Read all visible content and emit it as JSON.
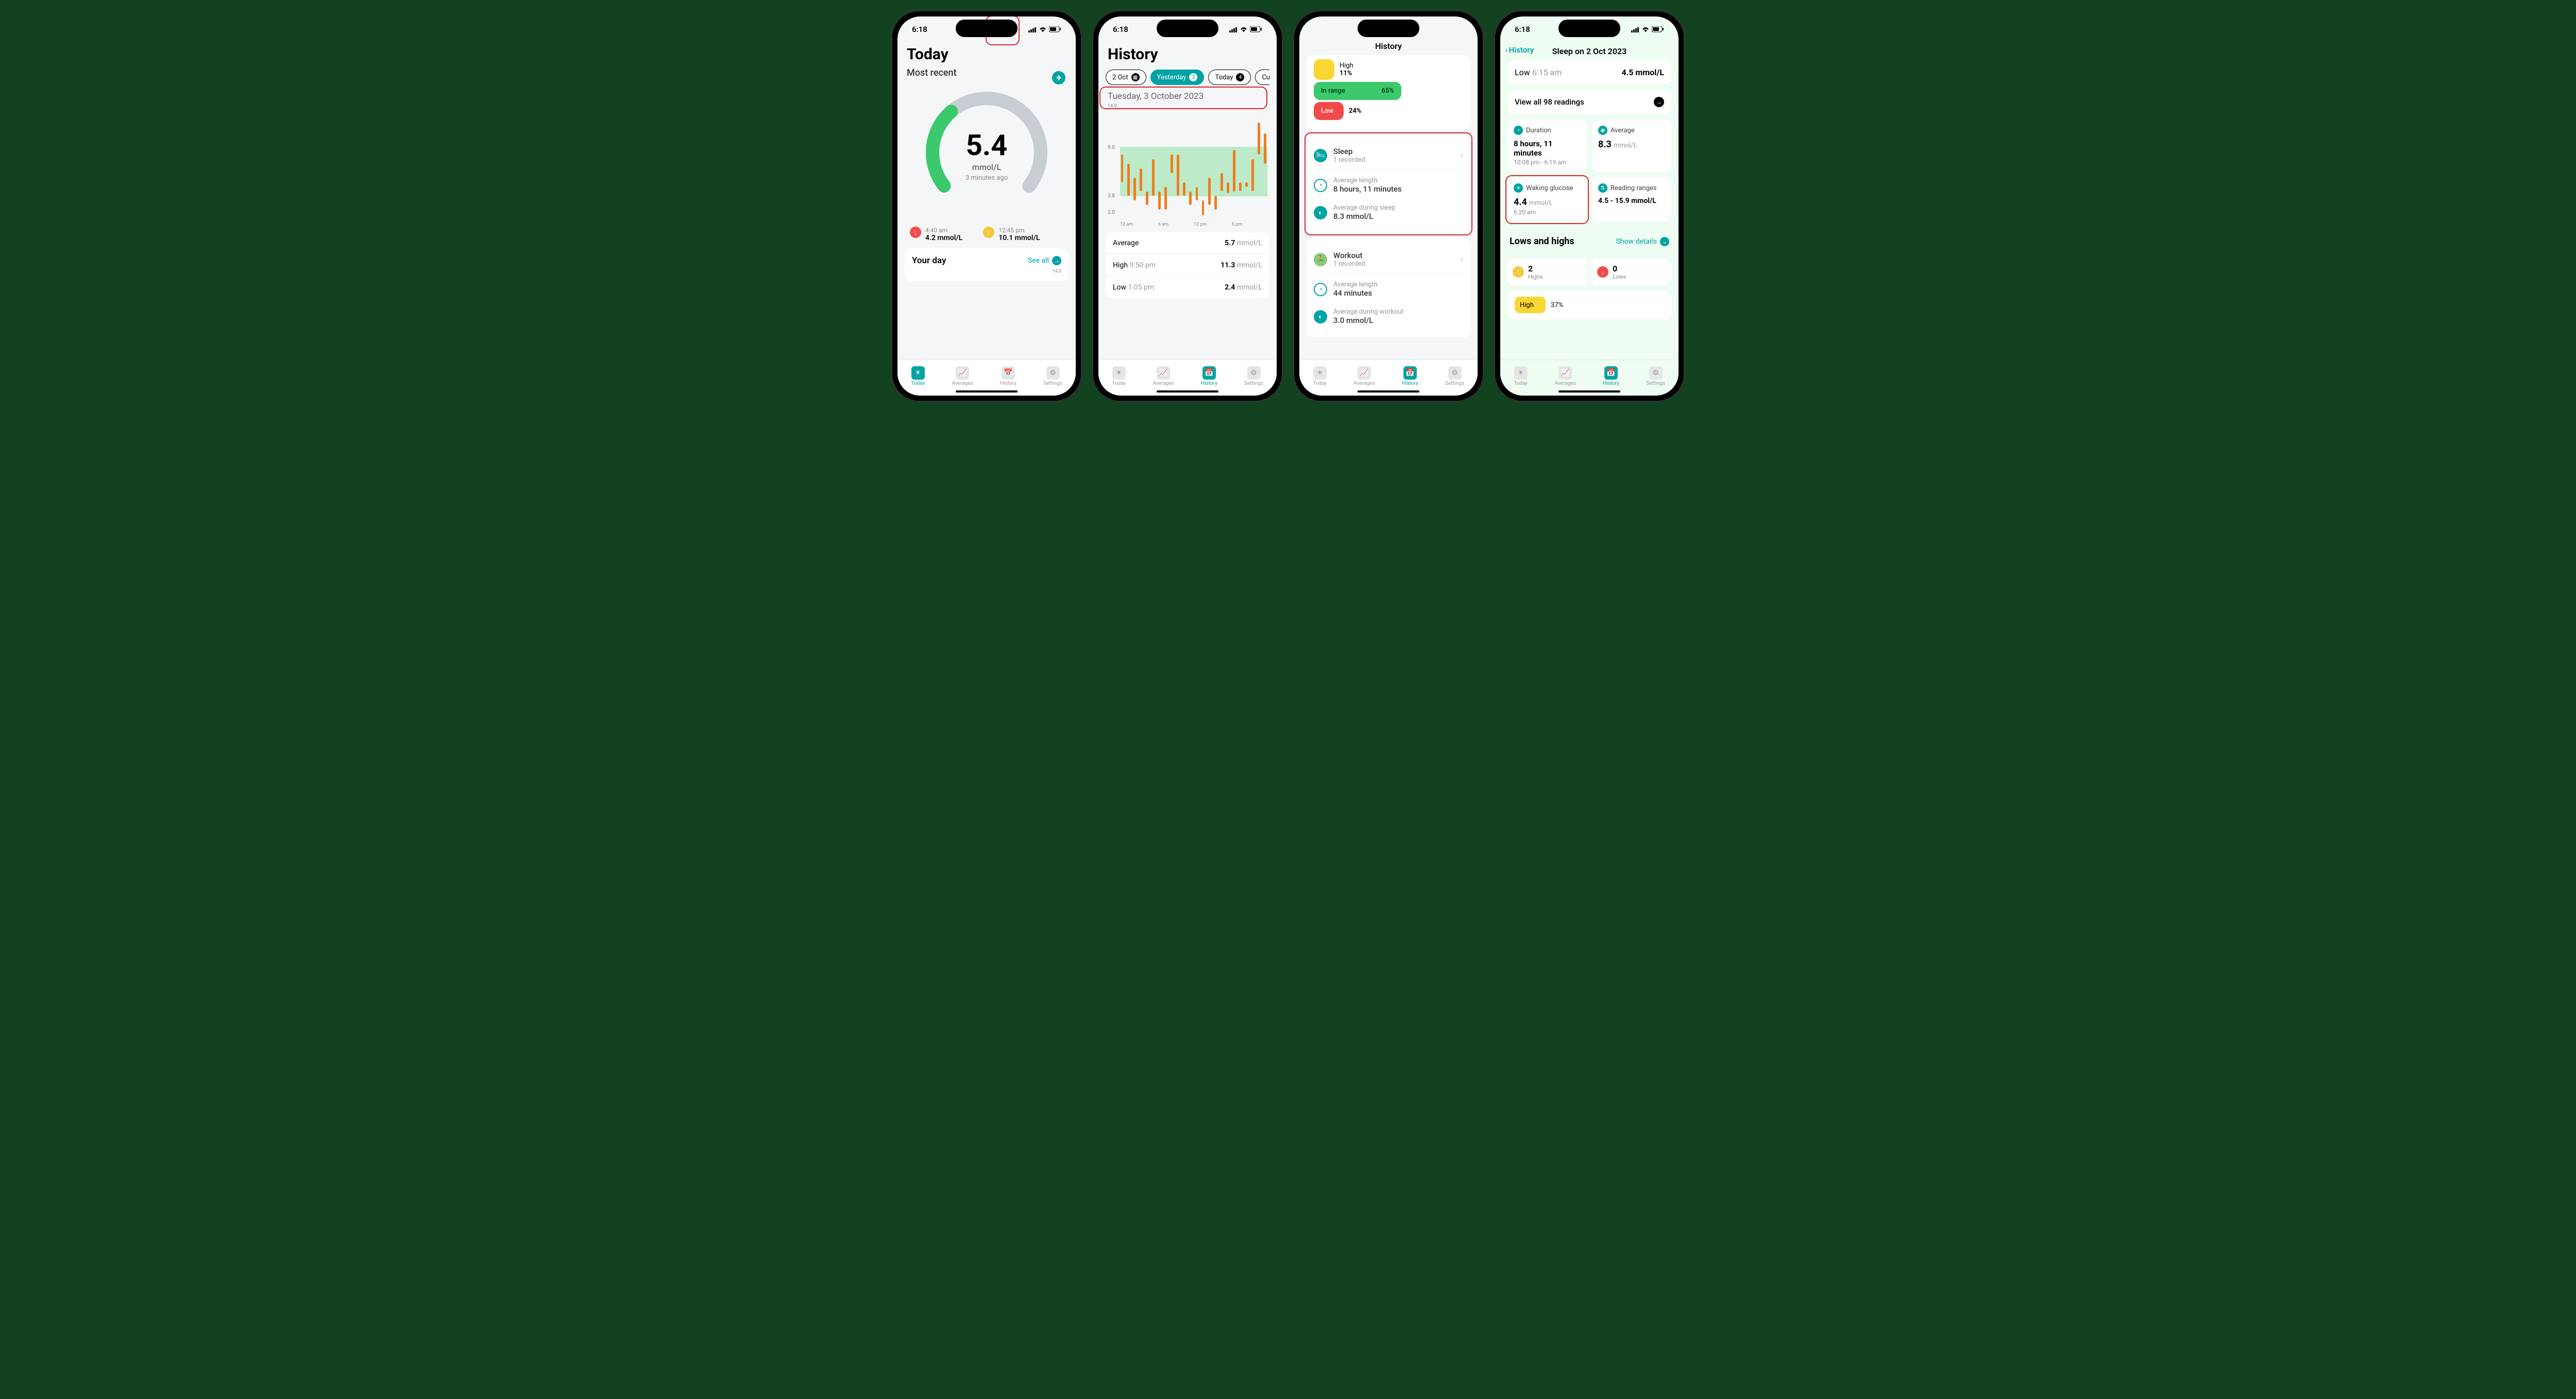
{
  "status": {
    "time": "6:18"
  },
  "tabs": {
    "today": "Today",
    "averages": "Averages",
    "history": "History",
    "settings": "Settings"
  },
  "p1": {
    "title": "Today",
    "section": "Most recent",
    "value": "5.4",
    "unit": "mmol/L",
    "ago": "3 minutes ago",
    "low_time": "4:40 am",
    "low_val": "4.2 mmol/L",
    "high_time": "12:45 pm",
    "high_val": "10.1 mmol/L",
    "yourday": "Your day",
    "seeall": "See all",
    "ymax": "14.0"
  },
  "p2": {
    "title": "History",
    "chips": {
      "c1": "2 Oct",
      "c2": "Yesterday",
      "c2b": "3",
      "c3": "Today",
      "c3b": "4",
      "c4": "Custo"
    },
    "date": "Tuesday, 3 October 2023",
    "ymax": "14.0",
    "y9": "9.0",
    "y38": "3.8",
    "y2": "2.0",
    "x": {
      "a": "12 am",
      "b": "6 am",
      "c": "12 pm",
      "d": "6 pm"
    },
    "avg_l": "Average",
    "avg_v": "5.7",
    "avg_u": "mmol/L",
    "high_l": "High",
    "high_t": "9:50 pm",
    "high_v": "11.3",
    "high_u": "mmol/L",
    "low_l": "Low",
    "low_t": "1:05 pm",
    "low_v": "2.4",
    "low_u": "mmol/L"
  },
  "p3": {
    "nav": "History",
    "high_l": "High",
    "high_v": "11%",
    "in_l": "In range",
    "in_v": "65%",
    "low_l": "Low",
    "low_v": "24%",
    "sleep": "Sleep",
    "sleep_sub": "1 recorded",
    "alen_l": "Average length",
    "alen_v": "8 hours, 11 minutes",
    "adur_l": "Average during sleep",
    "adur_v": "8.3 mmol/L",
    "workout": "Workout",
    "workout_sub": "1 recorded",
    "wlen_l": "Average length",
    "wlen_v": "44 minutes",
    "wdur_l": "Average during workout",
    "wdur_v": "3.0 mmol/L"
  },
  "p4": {
    "back": "History",
    "nav": "Sleep on 2 Oct 2023",
    "low_l": "Low",
    "low_t": "6:15 am",
    "low_v": "4.5 mmol/L",
    "viewall": "View all 98 readings",
    "dur_l": "Duration",
    "dur_v": "8 hours, 11 minutes",
    "dur_sub": "10:08 pm - 6:19 am",
    "avg_l": "Average",
    "avg_v": "8.3",
    "avg_u": "mmol/L",
    "wak_l": "Waking glucose",
    "wak_v": "4.4",
    "wak_u": "mmol/L",
    "wak_t": "6:20 am",
    "rng_l": "Reading ranges",
    "rng_v": "4.5 - 15.9 mmol/L",
    "lh_title": "Lows and highs",
    "lh_action": "Show details",
    "highs_n": "2",
    "highs_l": "Highs",
    "lows_n": "0",
    "lows_l": "Lows",
    "bar_l": "High",
    "bar_v": "37%"
  },
  "chart_data": {
    "type": "bar",
    "title": "Tuesday, 3 October 2023",
    "xlabel": "",
    "ylabel": "mmol/L",
    "ylim": [
      2.0,
      14.0
    ],
    "target_range": [
      3.8,
      9.0
    ],
    "x_ticks": [
      "12 am",
      "6 am",
      "12 pm",
      "6 pm"
    ],
    "series": [
      {
        "name": "glucose-range",
        "low": [
          6.0,
          4.5,
          4.0,
          5.0,
          3.5,
          4.5,
          3.0,
          3.0,
          7.0,
          4.5,
          4.5,
          3.5,
          4.0,
          2.4,
          3.5,
          3.0,
          5.0,
          4.8,
          5.0,
          5.0,
          5.5,
          5.0,
          9.0,
          8.0
        ],
        "high": [
          9.0,
          8.0,
          6.5,
          7.5,
          5.0,
          8.5,
          5.0,
          5.5,
          9.0,
          9.0,
          6.0,
          5.0,
          5.5,
          4.0,
          6.5,
          4.5,
          7.0,
          6.0,
          9.5,
          6.0,
          6.0,
          8.5,
          12.5,
          11.3
        ]
      }
    ]
  }
}
